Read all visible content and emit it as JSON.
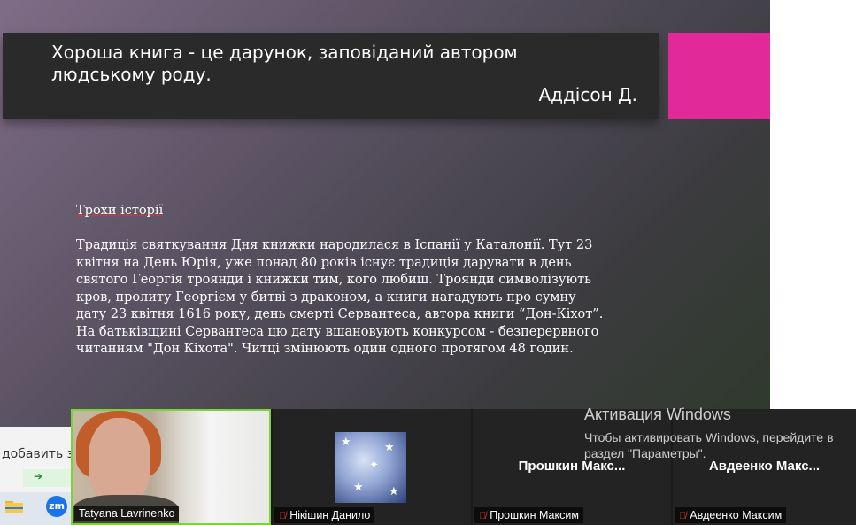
{
  "slide": {
    "quote": "Хороша книга - це дарунок, заповіданий автором людському роду.",
    "author": "Аддісон Д.",
    "history_title": "Трохи історії",
    "history_text": "Традиція святкування Дня книжки народилася в Іспанії у Каталонії. Тут 23 квітня на День Юрія, уже понад 80 років існує традиція дарувати в день святого Георгія троянди і книжки тим, кого любиш. Троянди символізують кров, пролиту Георгієм у битві з драконом, а книги нагадують про сумну дату 23 квітня 1616 року, день смерті Сервантеса, автора книги “Дон-Кіхот”. На батьківщині Сервантеса цю дату вшановують конкурсом - безперервного читанням \"Дон Кіхота\". Читці змінюють один одного протягом 48 годин.",
    "accent_color": "#e2299a"
  },
  "left_panel": {
    "add_text": "добавить за",
    "taskbar": {
      "zoom_label": "zm"
    }
  },
  "participants": [
    {
      "name": "Tatyana Lavrinenko",
      "muted": false,
      "video": true,
      "active": true
    },
    {
      "name": "Нікішин Данило",
      "muted": true,
      "video": false,
      "avatar": "anime-avatar"
    },
    {
      "name": "Прошкин Максим",
      "display": "Прошкин  Макс...",
      "muted": true,
      "video": false
    },
    {
      "name": "Авдеенко Максим",
      "display": "Авдеенко  Макс...",
      "muted": true,
      "video": false
    }
  ],
  "activation": {
    "title": "Активация Windows",
    "subtitle": "Чтобы активировать Windows, перейдите в раздел \"Параметры\"."
  }
}
